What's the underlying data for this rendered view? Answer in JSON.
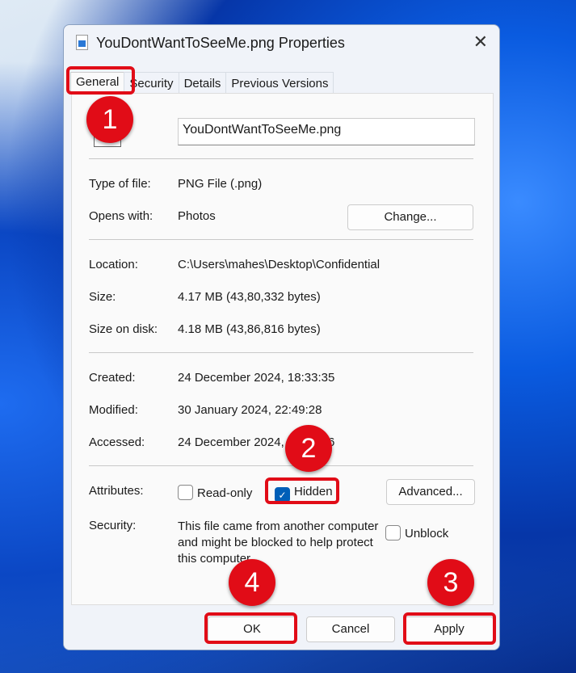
{
  "window": {
    "title": "YouDontWantToSeeMe.png Properties"
  },
  "tabs": [
    "General",
    "Security",
    "Details",
    "Previous Versions"
  ],
  "general": {
    "filename": "YouDontWantToSeeMe.png",
    "type_label": "Type of file:",
    "type_value": "PNG File (.png)",
    "opens_label": "Opens with:",
    "opens_value": "Photos",
    "change_button": "Change...",
    "location_label": "Location:",
    "location_value": "C:\\Users\\mahes\\Desktop\\Confidential",
    "size_label": "Size:",
    "size_value": "4.17 MB (43,80,332 bytes)",
    "disk_label": "Size on disk:",
    "disk_value": "4.18 MB (43,86,816 bytes)",
    "created_label": "Created:",
    "created_value": "24 December 2024, 18:33:35",
    "modified_label": "Modified:",
    "modified_value": "30 January 2024, 22:49:28",
    "accessed_label": "Accessed:",
    "accessed_value": "24 December 2024, 18:33:36",
    "attributes_label": "Attributes:",
    "readonly_label": "Read-only",
    "readonly_checked": false,
    "hidden_label": "Hidden",
    "hidden_checked": true,
    "advanced_button": "Advanced...",
    "security_label": "Security:",
    "security_text": "This file came from another computer and might be blocked to help protect this computer.",
    "unblock_label": "Unblock",
    "unblock_checked": false
  },
  "buttons": {
    "ok": "OK",
    "cancel": "Cancel",
    "apply": "Apply"
  },
  "annotations": [
    "1",
    "2",
    "3",
    "4"
  ]
}
